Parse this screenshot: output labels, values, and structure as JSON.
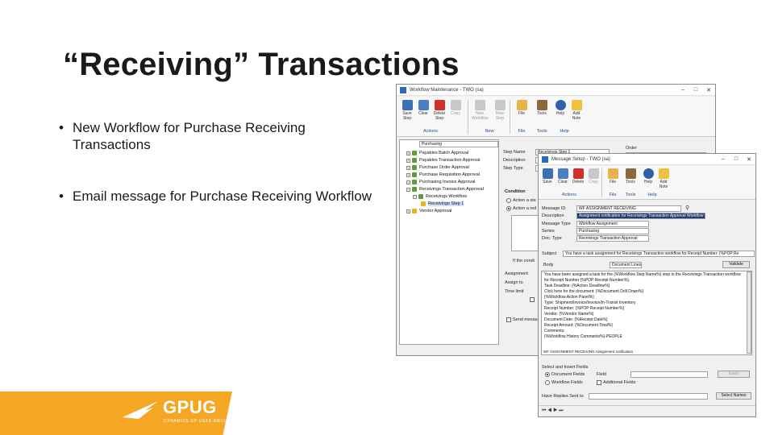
{
  "slide": {
    "title": "“Receiving” Transactions",
    "bullets": [
      "New Workflow for Purchase Receiving Transactions",
      "Email message for Purchase Receiving Workflow"
    ]
  },
  "logo": {
    "text": "GPUG",
    "subtitle": "DYNAMICS GP USER GROUP",
    "color": "#f5a623"
  },
  "workflow_window": {
    "title": "Workflow Maintenance - TWO (sa)",
    "ribbon_buttons": [
      "Save Step",
      "Clear",
      "Delete Step",
      "Copy",
      "New Workflow",
      "New Step",
      "File",
      "Tools",
      "Help",
      "Add Note"
    ],
    "ribbon_groups": [
      "Actions",
      "New",
      "File",
      "Tools",
      "Help"
    ],
    "workflow_type": "Purchasing",
    "tree": [
      "Payables Batch Approval",
      "Payables Transaction Approval",
      "Purchase Order Approval",
      "Purchase Requisition Approval",
      "Purchasing Invoice Approval",
      "Receivings Transaction Approval",
      "Receivings Workflow",
      "Receivings Step 1",
      "Vendor Approval"
    ],
    "fields": {
      "step_name_label": "Step Name",
      "step_name_value": "Receivings Step 1",
      "description_label": "Description",
      "step_type_label": "Step Type",
      "order_label": "Order",
      "condition_label": "Condition",
      "action_1": "Action a ste",
      "action_2": "Action a red",
      "if_the_condition": "If the condi",
      "assignment_label": "Assignment",
      "assign_to_label": "Assign to",
      "time_limit_label": "Time limit",
      "send_label": "Send messa"
    }
  },
  "message_window": {
    "title": "Message Setup - TWO (sa)",
    "ribbon_buttons": [
      "Save",
      "Clear",
      "Delete",
      "Copy",
      "File",
      "Tools",
      "Help",
      "Add Note"
    ],
    "ribbon_groups": [
      "Actions",
      "File",
      "Tools",
      "Help"
    ],
    "fields": {
      "message_id_label": "Message ID",
      "message_id_value": "WF ASSIGNMENT RECEIVING",
      "description_label": "Description",
      "description_value": "Assignment notification for Receivings Transaction Approval Workflow",
      "message_type_label": "Message Type",
      "message_type_value": "Workflow Assignment",
      "series_label": "Series",
      "series_value": "Purchasing",
      "doc_type_label": "Doc. Type",
      "doc_type_value": "Receivings Transaction Approval",
      "subject_label": "Subject",
      "subject_value": "You have a task assignment for Receivings Transaction workflow for Receipt Number: {%POP Re"
    },
    "body_label": "Body",
    "body_dropdown": "Document Lines",
    "validate_button": "Validate",
    "body_lines": [
      "You have been assigned a task for the {%Workflow Step Name%} step in the Receivings Transaction workflow",
      "for Receipt Number {%POP Receipt Number%}.",
      "",
      "Task Deadline: {%Action Deadline%}",
      "Click here for the document: {%Document Drill Down%}",
      "",
      "{%Workflow Action Panel%}",
      "",
      "Type: Shipment/Invoice/Invoice/In-Transit Inventory",
      "Receipt Number: {%POP Receipt Number%}",
      "Vendor: {%Vendor Name%}",
      "Document Date: {%Receipt Date%}",
      "Receipt Amount: {%Document Total%}",
      "",
      "Comments:",
      "{%Workflow History Comments%}-PEOPLE",
      "WF ASSIGNMENT RECEIVING                                   Assignment notification"
    ],
    "select_fields_label": "Select and Insert Fields",
    "document_fields_label": "Document Fields",
    "workflow_fields_label": "Workflow Fields",
    "field_label": "Field",
    "additional_fields_label": "Additional Fields",
    "insert_button": "Insert",
    "have_replies_label": "Have Replies Sent to",
    "select_names_button": "Select Names"
  }
}
